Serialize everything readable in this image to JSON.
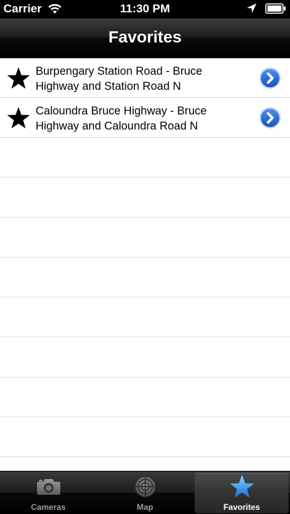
{
  "status_bar": {
    "carrier": "Carrier",
    "time": "11:30 PM"
  },
  "nav": {
    "title": "Favorites"
  },
  "favorites": [
    {
      "line1": "Burpengary Station Road - Bruce",
      "line2": "Highway and Station Road N",
      "icon": "star-icon",
      "accessory": "disclosure-chevron-icon"
    },
    {
      "line1": "Caloundra Bruce Highway - Bruce",
      "line2": "Highway and Caloundra Road N",
      "icon": "star-icon",
      "accessory": "disclosure-chevron-icon"
    }
  ],
  "tab_bar": {
    "tabs": [
      {
        "label": "Cameras",
        "icon": "camera-icon",
        "selected": false
      },
      {
        "label": "Map",
        "icon": "radar-icon",
        "selected": false
      },
      {
        "label": "Favorites",
        "icon": "star-icon",
        "selected": true
      }
    ]
  },
  "colors": {
    "disclosure_blue": "#2f6fd6",
    "selected_tab_star": "#4aa3ee"
  }
}
